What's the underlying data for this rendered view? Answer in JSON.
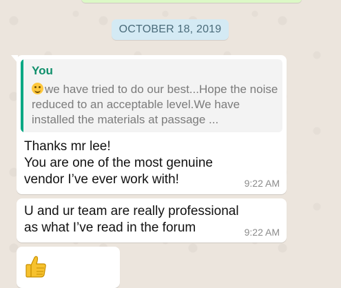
{
  "chat": {
    "date_chip": "OCTOBER 18, 2019",
    "messages": [
      {
        "quoted_author": "You",
        "quoted_emoji": "smiling-face",
        "quoted_text": "we have tried to do our best...Hope the noise reduced to an acceptable level.We have installed the materials at passage ...",
        "text_lines": [
          "Thanks mr lee!",
          "You are one of the most genuine",
          "vendor I’ve ever work with!"
        ],
        "time": "9:22 AM"
      },
      {
        "text_lines": [
          "U and ur team are really professional",
          "as what I’ve read in the forum"
        ],
        "time": "9:22 AM"
      },
      {
        "emoji": "thumbs-up"
      }
    ]
  },
  "colors": {
    "wallpaper": "#ece5dd",
    "incoming_bubble": "#ffffff",
    "outgoing_bubble": "#dcf8c6",
    "date_chip_bg": "#d4eaf4",
    "quote_accent": "#00a884"
  }
}
